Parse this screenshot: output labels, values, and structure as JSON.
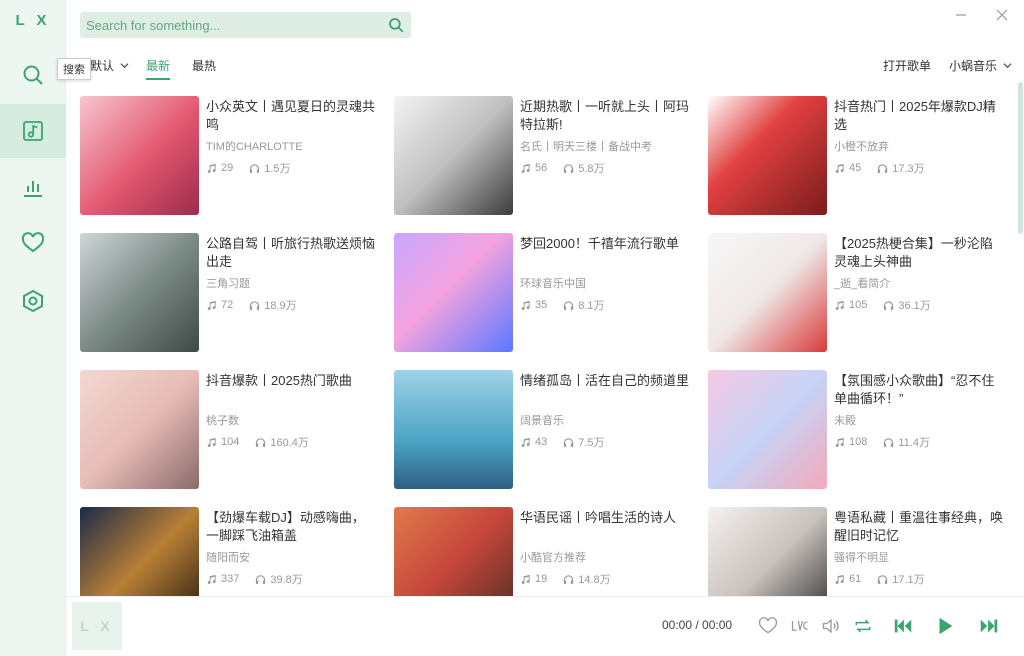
{
  "app": {
    "logo": "L X"
  },
  "colors": {
    "accent": "#3aa56f",
    "sidebar_bg": "#eef6f1",
    "search_bg": "#dfeee5"
  },
  "sidebar": {
    "items": [
      {
        "name": "search",
        "icon": "search-icon"
      },
      {
        "name": "songlist",
        "icon": "music-note-icon",
        "active": true
      },
      {
        "name": "leaderboard",
        "icon": "bar-chart-icon"
      },
      {
        "name": "favorites",
        "icon": "heart-icon"
      },
      {
        "name": "settings",
        "icon": "hexagon-icon"
      }
    ],
    "tooltip": "搜索"
  },
  "header": {
    "search_placeholder": "Search for something...",
    "window_controls": [
      "minimize-icon",
      "close-icon"
    ]
  },
  "tabbar": {
    "sort_label": "默认",
    "tabs": [
      {
        "label": "最新",
        "active": true
      },
      {
        "label": "最热",
        "active": false
      }
    ],
    "open_playlist": "打开歌单",
    "source": "小蜗音乐"
  },
  "cards": [
    {
      "title": "小众英文丨遇见夏日的灵魂共鸣",
      "author": "TIM的CHARLOTTE",
      "songs": "29",
      "plays": "1.5万"
    },
    {
      "title": "近期热歌丨一听就上头丨阿玛特拉斯!",
      "author": "名氏丨明天三楼丨备战中考",
      "songs": "56",
      "plays": "5.8万"
    },
    {
      "title": "抖音热门丨2025年爆款DJ精选",
      "author": "小橙不放弃",
      "songs": "45",
      "plays": "17.3万"
    },
    {
      "title": "公路自驾丨听旅行热歌送烦恼出走",
      "author": "三角习题",
      "songs": "72",
      "plays": "18.9万"
    },
    {
      "title": "梦回2000！千禧年流行歌单",
      "author": "环球音乐中国",
      "songs": "35",
      "plays": "8.1万"
    },
    {
      "title": "【2025热梗合集】一秒沦陷灵魂上头神曲",
      "author": "_逝_看简介",
      "songs": "105",
      "plays": "36.1万"
    },
    {
      "title": "抖音爆款丨2025热门歌曲",
      "author": "桃子数",
      "songs": "104",
      "plays": "160.4万"
    },
    {
      "title": "情绪孤岛丨活在自己的频道里",
      "author": "阔景音乐",
      "songs": "43",
      "plays": "7.5万"
    },
    {
      "title": "【氛围感小众歌曲】“忍不住单曲循环！”",
      "author": "末殿",
      "songs": "108",
      "plays": "11.4万"
    },
    {
      "title": "【劲爆车载DJ】动感嗨曲，一脚踩飞油箱盖",
      "author": "随阳而安",
      "songs": "337",
      "plays": "39.8万"
    },
    {
      "title": "华语民谣丨吟唱生活的诗人",
      "author": "小酷官方推荐",
      "songs": "19",
      "plays": "14.8万"
    },
    {
      "title": "粤语私藏丨重温往事经典，唤醒旧时记忆",
      "author": "骚得不明显",
      "songs": "61",
      "plays": "17.1万"
    }
  ],
  "player": {
    "art_placeholder": "L X",
    "time": "00:00 / 00:00",
    "controls": [
      "heart-icon",
      "lyrics-icon",
      "volume-icon",
      "repeat-icon",
      "previous-icon",
      "play-icon",
      "next-icon"
    ]
  }
}
